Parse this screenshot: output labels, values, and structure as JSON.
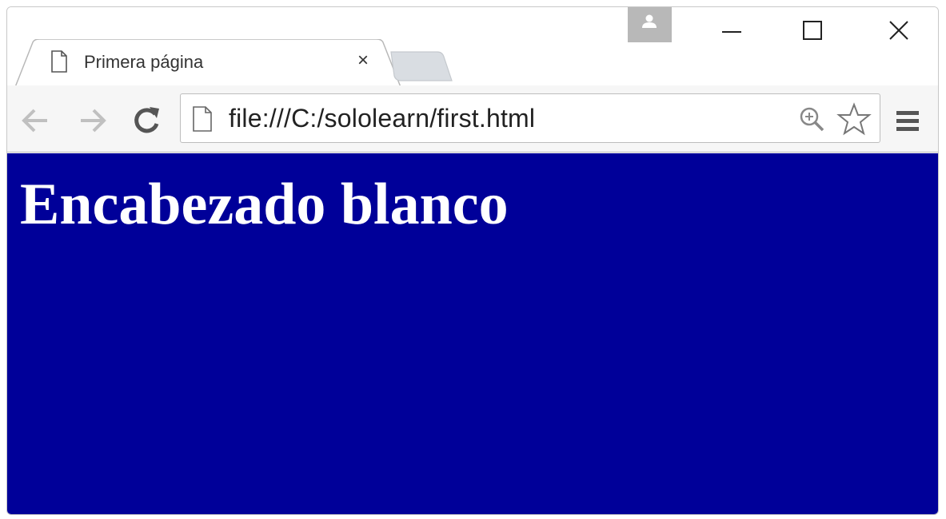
{
  "tabs": [
    {
      "title": "Primera página",
      "close_symbol": "×",
      "icon": "page-icon",
      "active": true
    }
  ],
  "window_controls": {
    "profile_icon": "person-icon",
    "minimize_icon": "minimize-icon",
    "maximize_icon": "maximize-icon",
    "close_icon": "close-icon"
  },
  "toolbar": {
    "back_icon": "back-arrow-icon",
    "forward_icon": "forward-arrow-icon",
    "reload_icon": "reload-icon",
    "menu_icon": "hamburger-menu-icon"
  },
  "omnibox": {
    "url": "file:///C:/sololearn/first.html",
    "page_icon": "page-icon",
    "zoom_icon": "zoom-in-icon",
    "bookmark_icon": "star-icon"
  },
  "page": {
    "heading": "Encabezado blanco",
    "background_color": "#000099",
    "heading_color": "#ffffff"
  }
}
